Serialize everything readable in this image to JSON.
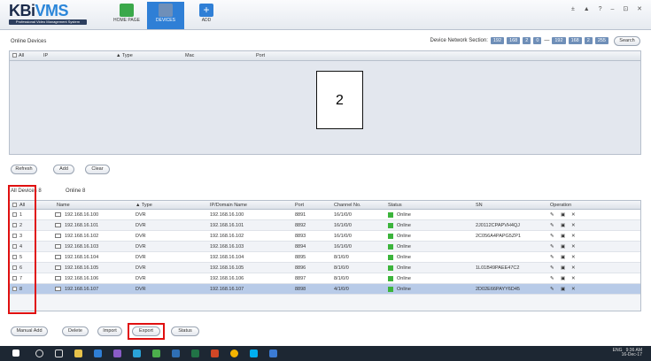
{
  "app": {
    "logo_main": "KBi",
    "logo_accent": "VMS",
    "logo_sub": "Professional Video Management System"
  },
  "nav": [
    {
      "label": "HOME PAGE",
      "color": "#3aa84a"
    },
    {
      "label": "DEVICES",
      "color": "#5b7fa6"
    },
    {
      "label": "ADD",
      "color": "#2f7fd6"
    }
  ],
  "window_controls": "± ▲ ? – ⊡ ✕",
  "online_devices": {
    "title": "Online Devices",
    "network_label": "Device Network Section:",
    "ip_start": [
      "192",
      "168",
      "2",
      "0"
    ],
    "separator": "—",
    "ip_end": [
      "192",
      "168",
      "2",
      "255"
    ],
    "search_label": "Search",
    "columns": [
      "All",
      "IP",
      "▲ Type",
      "Mac",
      "Port"
    ],
    "annotation": "2",
    "buttons": [
      "Refresh",
      "Add",
      "Clear"
    ]
  },
  "all_devices": {
    "count_label": "All Devices 8",
    "online_label": "Online 8",
    "columns": [
      "All",
      "Name",
      "▲ Type",
      "IP/Domain Name",
      "Port",
      "Channel No.",
      "Status",
      "SN",
      "Operation"
    ],
    "rows": [
      {
        "no": "1",
        "name": "192.168.16.100",
        "type": "DVR",
        "ip": "192.168.16.100",
        "port": "8891",
        "channel": "16/1/0/0",
        "status": "Online",
        "sn": ""
      },
      {
        "no": "2",
        "name": "192.168.16.101",
        "type": "DVR",
        "ip": "192.168.16.101",
        "port": "8892",
        "channel": "16/1/0/0",
        "status": "Online",
        "sn": "2J0112CPAPVH4QJ"
      },
      {
        "no": "3",
        "name": "192.168.16.102",
        "type": "DVR",
        "ip": "192.168.16.102",
        "port": "8893",
        "channel": "16/1/0/0",
        "status": "Online",
        "sn": "2C056A4PAPG5ZP1"
      },
      {
        "no": "4",
        "name": "192.168.16.103",
        "type": "DVR",
        "ip": "192.168.16.103",
        "port": "8894",
        "channel": "16/1/0/0",
        "status": "Online",
        "sn": ""
      },
      {
        "no": "5",
        "name": "192.168.16.104",
        "type": "DVR",
        "ip": "192.168.16.104",
        "port": "8895",
        "channel": "8/1/0/0",
        "status": "Online",
        "sn": ""
      },
      {
        "no": "6",
        "name": "192.168.16.105",
        "type": "DVR",
        "ip": "192.168.16.105",
        "port": "8896",
        "channel": "8/1/0/0",
        "status": "Online",
        "sn": "1L01B49PAEE47C2"
      },
      {
        "no": "7",
        "name": "192.168.16.106",
        "type": "DVR",
        "ip": "192.168.16.106",
        "port": "8897",
        "channel": "8/1/0/0",
        "status": "Online",
        "sn": ""
      },
      {
        "no": "8",
        "name": "192.168.16.107",
        "type": "DVR",
        "ip": "192.168.16.107",
        "port": "8898",
        "channel": "4/1/0/0",
        "status": "Online",
        "sn": "2D02E66PAYY6D45"
      }
    ],
    "buttons": [
      "Manual Add",
      "Delete",
      "Import",
      "Export",
      "Status"
    ]
  },
  "taskbar": {
    "lang": "ENG",
    "time": "9:36 AM",
    "date": "16-Dec-17"
  },
  "colors": {
    "accent": "#2f7fd6",
    "online": "#3cb43c",
    "selected_row": "#b8cbe8",
    "highlight_box": "#e01010"
  }
}
